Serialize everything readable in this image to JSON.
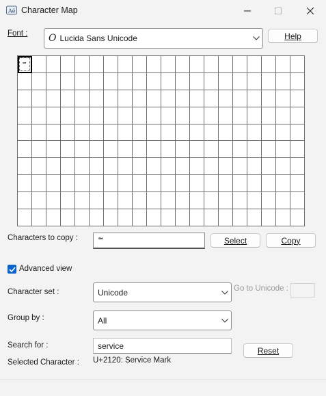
{
  "window": {
    "title": "Character Map",
    "icons": {
      "app": "character-map-icon",
      "minimize": "minimize-icon",
      "maximize": "maximize-icon",
      "close": "close-icon"
    }
  },
  "font_row": {
    "label": "Font :",
    "selected": "Lucida Sans Unicode",
    "font_type_icon": "opentype-icon",
    "help_label": "Help"
  },
  "grid": {
    "columns": 20,
    "rows": 10,
    "selected_char": "℠"
  },
  "copy_row": {
    "label": "Characters to copy :",
    "value": "℠",
    "select_label": "Select",
    "copy_label": "Copy"
  },
  "advanced": {
    "label": "Advanced view",
    "checked": true
  },
  "character_set": {
    "label": "Character set :",
    "selected": "Unicode",
    "goto_label": "Go to Unicode :"
  },
  "group_by": {
    "label": "Group by :",
    "selected": "All"
  },
  "search": {
    "label": "Search for :",
    "value": "service",
    "reset_label": "Reset"
  },
  "status": {
    "label": "Selected Character :",
    "value": "U+2120: Service Mark"
  },
  "colors": {
    "accent": "#0a64c8",
    "background": "#f3f3f3"
  }
}
